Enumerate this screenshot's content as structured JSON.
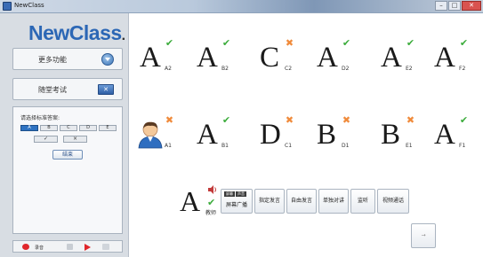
{
  "window": {
    "title": "NewClass",
    "buttons": [
      "–",
      "□",
      "✕"
    ]
  },
  "sidebar": {
    "logo": "NewClass",
    "logo_dot": ".",
    "more_label": "更多功能",
    "exam_label": "随堂考试",
    "answer_prompt": "请选择标准答案:",
    "choices": [
      "A",
      "B",
      "C",
      "D",
      "E"
    ],
    "selected_choice": "A",
    "true_label": "✓",
    "false_label": "×",
    "end_label": "结束",
    "bottom_label": "录音"
  },
  "students": [
    {
      "letter": "A",
      "status": "correct",
      "id": "A2"
    },
    {
      "letter": "A",
      "status": "correct",
      "id": "B2"
    },
    {
      "letter": "C",
      "status": "wrong",
      "id": "C2"
    },
    {
      "letter": "A",
      "status": "correct",
      "id": "D2"
    },
    {
      "letter": "A",
      "status": "correct",
      "id": "E2"
    },
    {
      "letter": "A",
      "status": "correct",
      "id": "F2"
    },
    {
      "letter": "",
      "status": "wrong",
      "id": "A1",
      "avatar": true
    },
    {
      "letter": "A",
      "status": "correct",
      "id": "B1"
    },
    {
      "letter": "D",
      "status": "wrong",
      "id": "C1"
    },
    {
      "letter": "B",
      "status": "wrong",
      "id": "D1"
    },
    {
      "letter": "B",
      "status": "wrong",
      "id": "E1"
    },
    {
      "letter": "A",
      "status": "correct",
      "id": "F1"
    }
  ],
  "teacher": {
    "letter": "A",
    "name": "教师"
  },
  "toolbar": {
    "broadcast_tags": [
      "屏幕",
      "声音"
    ],
    "buttons": [
      "屏幕广播",
      "指定发言",
      "自由发言",
      "单独对讲",
      "监听",
      "视频通话",
      "→"
    ]
  },
  "colors": {
    "correct": "#3cac3c",
    "wrong": "#f08a3a",
    "brand": "#2c67b5"
  }
}
